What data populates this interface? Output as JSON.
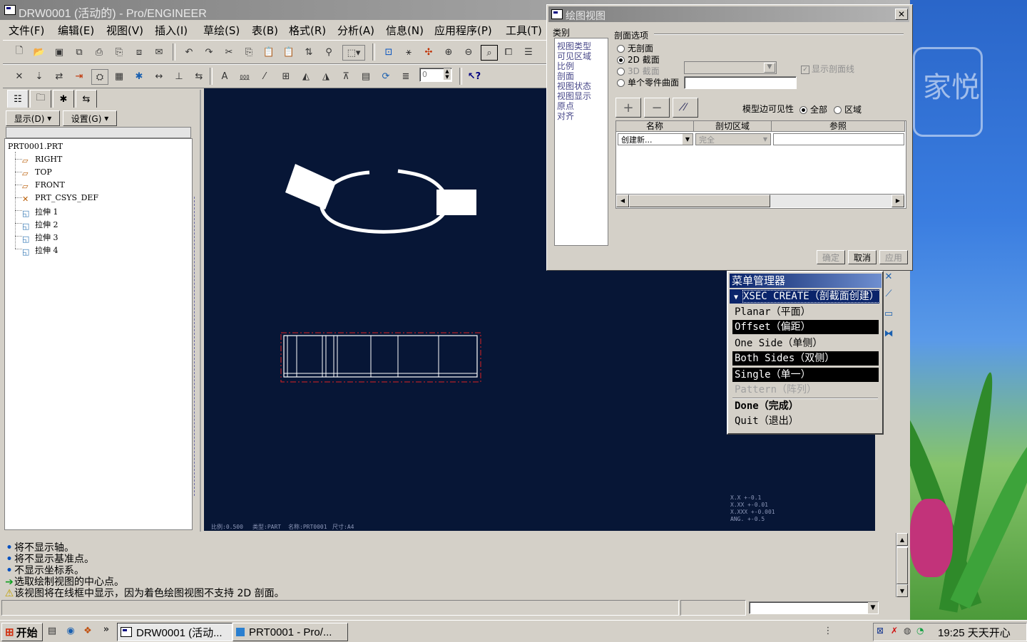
{
  "window": {
    "title": "DRW0001 (活动的) - Pro/ENGINEER"
  },
  "menubar": [
    {
      "label": "文件(F)"
    },
    {
      "label": "编辑(E)"
    },
    {
      "label": "视图(V)"
    },
    {
      "label": "插入(I)"
    },
    {
      "label": "草绘(S)"
    },
    {
      "label": "表(B)"
    },
    {
      "label": "格式(R)"
    },
    {
      "label": "分析(A)"
    },
    {
      "label": "信息(N)"
    },
    {
      "label": "应用程序(P)"
    },
    {
      "label": "工具(T)"
    }
  ],
  "toolbar2": {
    "spinner_value": "0"
  },
  "left_panel": {
    "show_label": "显示(D)",
    "settings_label": "设置(G)",
    "tree": {
      "root": "PRT0001.PRT",
      "items": [
        "RIGHT",
        "TOP",
        "FRONT",
        "PRT_CSYS_DEF",
        "拉伸 1",
        "拉伸 2",
        "拉伸 3",
        "拉伸 4"
      ]
    }
  },
  "canvas": {
    "status": [
      "比例:0.500",
      "类型:PART",
      "名称:PRT0001",
      "尺寸:A4"
    ],
    "tolerances": [
      "X.X   +-0.1",
      "X.XX  +-0.01",
      "X.XXX +-0.001",
      "ANG.  +-0.5"
    ]
  },
  "messages": [
    {
      "icon": "bullet-icon",
      "text": "将不显示轴。"
    },
    {
      "icon": "bullet-icon",
      "text": "将不显示基准点。"
    },
    {
      "icon": "bullet-icon",
      "text": "不显示坐标系。"
    },
    {
      "icon": "arrow-icon",
      "text": "选取绘制视图的中心点。"
    },
    {
      "icon": "warning-icon",
      "text": "该视图将在线框中显示，因为着色绘图视图不支持 2D 剖面。"
    }
  ],
  "dialog": {
    "title": "绘图视图",
    "category_label": "类别",
    "categories": [
      "视图类型",
      "可见区域",
      "比例",
      "剖面",
      "视图状态",
      "视图显示",
      "原点",
      "对齐"
    ],
    "section_options_label": "剖面选项",
    "options": [
      "无剖面",
      "2D 截面",
      "3D 截面",
      "单个零件曲面"
    ],
    "selected_option": "2D 截面",
    "show_hatch_label": "显示剖面线",
    "edge_visibility_label": "模型边可见性",
    "edge_all": "全部",
    "edge_area": "区域",
    "table": {
      "headers": [
        "名称",
        "剖切区域",
        "参照"
      ],
      "row": {
        "name": "创建新...",
        "region": "完全",
        "ref": ""
      }
    },
    "buttons": {
      "ok": "确定",
      "cancel": "取消",
      "apply": "应用"
    }
  },
  "menu_manager": {
    "title": "菜单管理器",
    "header": "XSEC CREATE（剖截面创建）",
    "items": [
      {
        "label": "Planar（平面）",
        "state": "normal"
      },
      {
        "label": "Offset（偏距）",
        "state": "selected"
      },
      {
        "label": "One Side（单侧）",
        "state": "normal"
      },
      {
        "label": "Both Sides（双侧）",
        "state": "selected"
      },
      {
        "label": "Single（单一）",
        "state": "selected"
      },
      {
        "label": "Pattern（阵列）",
        "state": "disabled"
      },
      {
        "label": "Done（完成）",
        "state": "bold"
      },
      {
        "label": "Quit（退出）",
        "state": "normal"
      }
    ]
  },
  "taskbar": {
    "start_label": "开始",
    "tasks": [
      {
        "label": "DRW0001 (活动..."
      },
      {
        "label": "PRT0001 - Pro/..."
      }
    ],
    "clock": "19:25 天天开心"
  },
  "desktop": {
    "logo_text": "家悦"
  },
  "colors": {
    "canvas_bg": "#071636",
    "menu_title": "#0a246a",
    "selection": "#000000"
  }
}
